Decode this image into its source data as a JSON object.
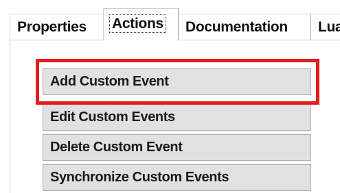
{
  "tabs": [
    {
      "label": "Properties",
      "active": false
    },
    {
      "label": "Actions",
      "active": true
    },
    {
      "label": "Documentation",
      "active": false
    },
    {
      "label": "Lua",
      "active": false
    }
  ],
  "actions": [
    {
      "label": "Add Custom Event",
      "highlighted": true
    },
    {
      "label": "Edit Custom Events",
      "highlighted": false
    },
    {
      "label": "Delete Custom Event",
      "highlighted": false
    },
    {
      "label": "Synchronize Custom Events",
      "highlighted": false
    }
  ],
  "colors": {
    "highlight": "#e61c1c",
    "button_face": "#e1e1e1",
    "button_border": "#adadad"
  }
}
